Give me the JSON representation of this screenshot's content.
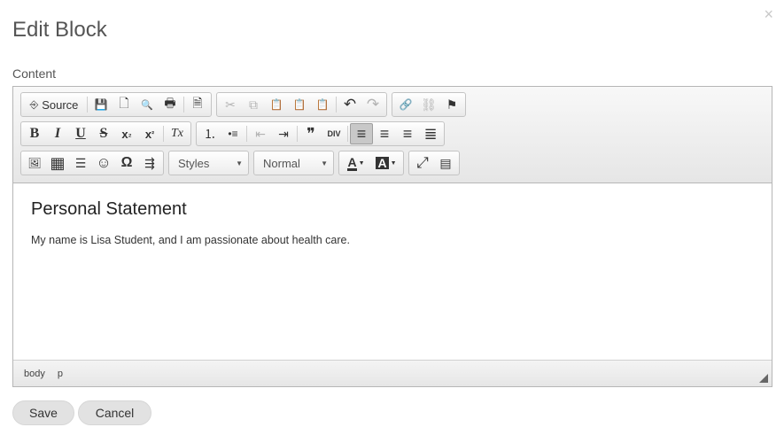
{
  "dialog": {
    "title": "Edit Block",
    "close_glyph": "×"
  },
  "field": {
    "label": "Content"
  },
  "toolbar": {
    "source_label": "Source",
    "styles_label": "Styles",
    "format_label": "Normal",
    "icons": {
      "source": "⎆",
      "save": "💾",
      "new_page": "🗋",
      "preview": "🔍",
      "print": "🖶",
      "templates": "🗎",
      "cut": "✂",
      "copy": "⧉",
      "paste": "📋",
      "paste_text": "📋",
      "paste_word": "📋",
      "undo": "↶",
      "redo": "↷",
      "link": "🔗",
      "unlink": "⛓",
      "anchor": "⚑",
      "bold": "B",
      "italic": "I",
      "underline": "U",
      "strike": "S",
      "subscript": "x",
      "subscript_mark": "₂",
      "superscript": "x",
      "superscript_mark": "²",
      "remove_format": "Tx",
      "numbered_list": "⒈",
      "bulleted_list": "•≡",
      "outdent": "⇤",
      "indent": "⇥",
      "blockquote": "❞",
      "create_div": "DIV",
      "align_left": "≡",
      "align_center": "≡",
      "align_right": "≡",
      "align_justify": "≣",
      "image": "🖼",
      "table": "▦",
      "horizontal_rule": "☰",
      "smiley": "☺",
      "special_char": "Ω",
      "page_break": "⇶",
      "dropdown_arrow": "▼",
      "text_color": "A",
      "bg_color": "A",
      "maximize": "⤢",
      "show_blocks": "▤"
    }
  },
  "content": {
    "heading": "Personal Statement",
    "paragraph": "My name is Lisa Student, and I am passionate about health care."
  },
  "statusbar": {
    "path": [
      "body",
      "p"
    ]
  },
  "actions": {
    "save_label": "Save",
    "cancel_label": "Cancel"
  }
}
